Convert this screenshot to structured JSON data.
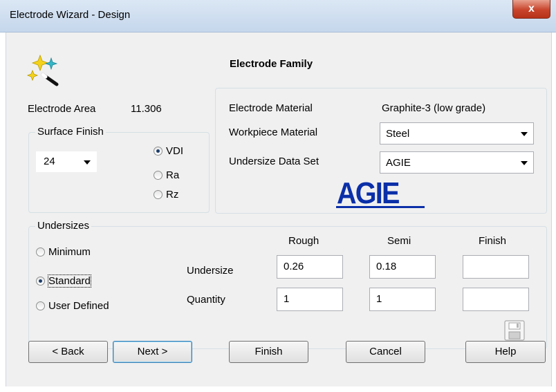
{
  "window": {
    "title": "Electrode Wizard - Design",
    "close_glyph": "x"
  },
  "header": {
    "title": "Electrode Family",
    "icon": "sparkle-wand-icon"
  },
  "electrode_area": {
    "label": "Electrode Area",
    "value": "11.306"
  },
  "surface_finish": {
    "legend": "Surface Finish",
    "value": "24",
    "options": [
      {
        "label": "VDI",
        "selected": true
      },
      {
        "label": "Ra",
        "selected": false
      },
      {
        "label": "Rz",
        "selected": false
      }
    ]
  },
  "materials": {
    "electrode_material_label": "Electrode Material",
    "electrode_material_value": "Graphite-3 (low grade)",
    "workpiece_material_label": "Workpiece Material",
    "workpiece_material_value": "Steel",
    "undersize_data_set_label": "Undersize Data Set",
    "undersize_data_set_value": "AGIE",
    "logo_text": "AGIE"
  },
  "undersizes": {
    "legend": "Undersizes",
    "options": [
      {
        "label": "Minimum",
        "selected": false
      },
      {
        "label": "Standard",
        "selected": true
      },
      {
        "label": "User Defined",
        "selected": false
      }
    ],
    "columns": [
      "Rough",
      "Semi",
      "Finish"
    ],
    "rows": [
      {
        "label": "Undersize",
        "values": [
          "0.26",
          "0.18",
          ""
        ]
      },
      {
        "label": "Quantity",
        "values": [
          "1",
          "1",
          ""
        ]
      }
    ],
    "save_icon": "save-icon"
  },
  "buttons": {
    "back": "< Back",
    "next": "Next >",
    "finish": "Finish",
    "cancel": "Cancel",
    "help": "Help"
  }
}
